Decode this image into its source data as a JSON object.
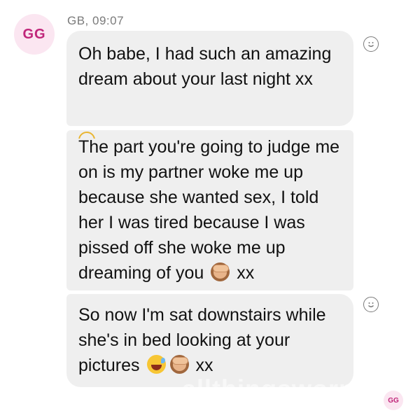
{
  "sender": {
    "avatar_initials": "GG",
    "meta": "GB, 09:07"
  },
  "messages": [
    {
      "text": "Oh babe, I had such an amazing dream about your last night xx"
    },
    {
      "text_before": "The part you're going to judge me on is my partner woke me up because she wanted sex, I told her I was tired because I was pissed off she woke me up dreaming of you",
      "emojis": [
        "see-no-evil-monkey"
      ],
      "text_after": "xx"
    },
    {
      "text_before": "So now I'm sat downstairs while she's in bed looking at your pictures",
      "emojis": [
        "grinning-sweat",
        "see-no-evil-monkey"
      ],
      "text_after": "xx"
    }
  ],
  "read_receipt_avatar": "GG",
  "watermark": "allthingsworn",
  "colors": {
    "bubble": "#efefef",
    "avatar_bg": "#fbe6f1",
    "avatar_text": "#c0267a",
    "meta_text": "#7a7a7a"
  }
}
